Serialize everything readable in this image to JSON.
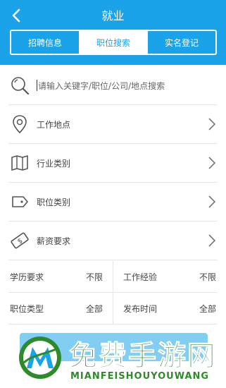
{
  "header": {
    "title": "就业",
    "tabs": [
      {
        "label": "招聘信息",
        "active": false
      },
      {
        "label": "职位搜索",
        "active": true
      },
      {
        "label": "实名登记",
        "active": false
      }
    ]
  },
  "search": {
    "placeholder": "请输入关键字/职位/公司/地点搜索"
  },
  "rows": {
    "location": "工作地点",
    "industry": "行业类别",
    "position": "职位类别",
    "salary": "薪资要求"
  },
  "filters": {
    "education_label": "学历要求",
    "education_value": "不限",
    "experience_label": "工作经验",
    "experience_value": "不限",
    "job_type_label": "职位类型",
    "job_type_value": "全部",
    "publish_time_label": "发布时间",
    "publish_time_value": "全部"
  },
  "watermark": {
    "chinese": "免费手游网",
    "english": "MIANFEISHOUYOUWANG"
  },
  "colors": {
    "primary": "#1aa3e8",
    "watermark_green": "#2f8a2b"
  }
}
